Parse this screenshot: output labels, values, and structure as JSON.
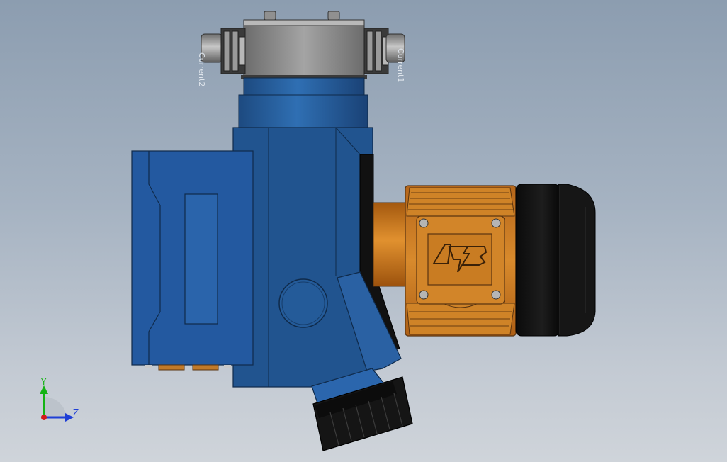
{
  "viewport": {
    "labels": {
      "left_port": "Current2",
      "right_port": "Current1"
    },
    "logo_text": "ATB",
    "triad": {
      "y_label": "Y",
      "z_label": "Z"
    },
    "colors": {
      "pump_blue": "#21548f",
      "pump_blue_light": "#2c6aac",
      "motor_orange": "#c9761e",
      "manifold_gray": "#8a8a8a",
      "rubber_black": "#111111",
      "axis_y": "#14b314",
      "axis_z": "#1f3fd6"
    }
  }
}
